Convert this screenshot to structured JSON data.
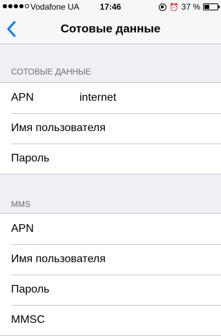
{
  "status_bar": {
    "carrier": "Vodafone UA",
    "time": "17:46",
    "battery": "37 %",
    "battery_level": 0.37,
    "signal_bars_filled": 4,
    "signal_bars_total": 5
  },
  "nav": {
    "title": "Сотовые данные",
    "back_icon": "chevron-left-icon",
    "accent_color": "#007aff"
  },
  "sections": [
    {
      "header": "СОТОВЫЕ ДАННЫЕ",
      "rows": [
        {
          "label": "APN",
          "value": "internet"
        },
        {
          "label": "Имя пользователя",
          "value": ""
        },
        {
          "label": "Пароль",
          "value": ""
        }
      ]
    },
    {
      "header": "MMS",
      "rows": [
        {
          "label": "APN",
          "value": ""
        },
        {
          "label": "Имя пользователя",
          "value": ""
        },
        {
          "label": "Пароль",
          "value": ""
        },
        {
          "label": "MMSC",
          "value": ""
        }
      ]
    }
  ]
}
